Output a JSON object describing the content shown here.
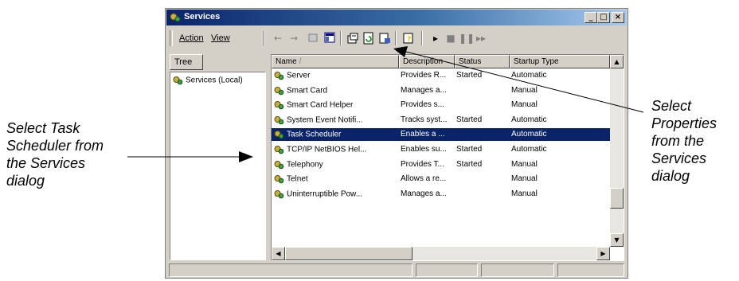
{
  "window": {
    "title": "Services"
  },
  "menu": {
    "action": "Action",
    "view": "View"
  },
  "toolbar": {
    "icons": [
      "back-arrow",
      "forward-arrow",
      "up-folder",
      "show-hide-console-tree",
      "properties",
      "refresh",
      "export-list",
      "help",
      "start-service",
      "stop-service",
      "pause-service",
      "restart-service"
    ]
  },
  "tree": {
    "tab_label": "Tree",
    "root_label": "Services (Local)"
  },
  "list": {
    "columns": [
      "Name",
      "Description",
      "Status",
      "Startup Type"
    ],
    "rows": [
      {
        "name": "Server",
        "description": "Provides R...",
        "status": "Started",
        "startup": "Automatic",
        "selected": false
      },
      {
        "name": "Smart Card",
        "description": "Manages a...",
        "status": "",
        "startup": "Manual",
        "selected": false
      },
      {
        "name": "Smart Card Helper",
        "description": "Provides s...",
        "status": "",
        "startup": "Manual",
        "selected": false
      },
      {
        "name": "System Event Notifi...",
        "description": "Tracks syst...",
        "status": "Started",
        "startup": "Automatic",
        "selected": false
      },
      {
        "name": "Task Scheduler",
        "description": "Enables a ...",
        "status": "",
        "startup": "Automatic",
        "selected": true
      },
      {
        "name": "TCP/IP NetBIOS Hel...",
        "description": "Enables su...",
        "status": "Started",
        "startup": "Automatic",
        "selected": false
      },
      {
        "name": "Telephony",
        "description": "Provides T...",
        "status": "Started",
        "startup": "Manual",
        "selected": false
      },
      {
        "name": "Telnet",
        "description": "Allows a re...",
        "status": "",
        "startup": "Manual",
        "selected": false
      },
      {
        "name": "Uninterruptible Pow...",
        "description": "Manages a...",
        "status": "",
        "startup": "Manual",
        "selected": false
      }
    ]
  },
  "callouts": {
    "left": [
      "Select Task",
      "Scheduler from",
      "the Services",
      "dialog"
    ],
    "right": [
      "Select",
      "Properties",
      "from the",
      "Services",
      "dialog"
    ]
  },
  "colors": {
    "title_active": "#0a246a",
    "selection": "#0a246a",
    "face": "#d4d0c8"
  }
}
